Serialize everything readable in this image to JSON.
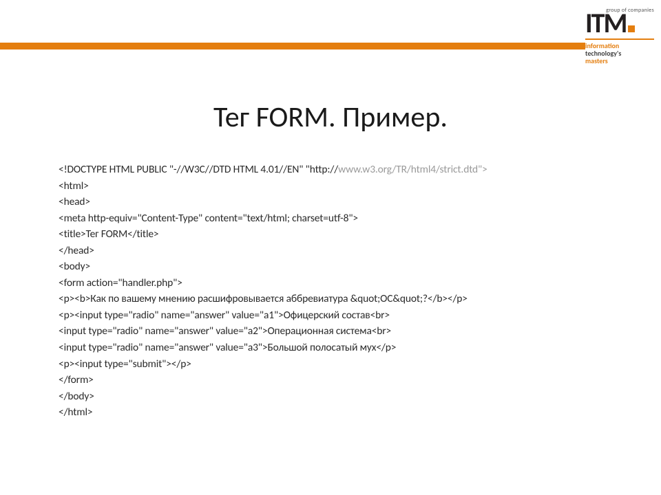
{
  "logo": {
    "group": "group of companies",
    "brand": "ITM",
    "tag1": "information",
    "tag2": "technology's",
    "tag3": "masters"
  },
  "title": "Тег FORM. Пример.",
  "code": {
    "l1a": "<!DOCTYPE HTML PUBLIC \"-//W3C//DTD HTML 4.01//EN\" \"http://",
    "l1b": "www.w3.org/TR/html4/strict.dtd\">",
    "l2": "<html>",
    "l3": " <head>",
    "l4": "  <meta http-equiv=\"Content-Type\" content=\"text/html; charset=utf-8\">",
    "l5": "  <title>Тег FORM</title>",
    "l6": " </head>",
    "l7": " <body>",
    "l8": " <form action=\"handler.php\">",
    "l9": "  <p><b>Как по вашему мнению расшифровывается аббревиатура &quot;ОС&quot;?</b></p>",
    "l10": "  <p><input type=\"radio\" name=\"answer\" value=\"a1\">Офицерский состав<br>",
    "l11": "  <input type=\"radio\" name=\"answer\" value=\"a2\">Операционная система<br>",
    "l12": "  <input type=\"radio\" name=\"answer\" value=\"a3\">Большой полосатый мух</p>",
    "l13": "  <p><input type=\"submit\"></p>",
    "l14": " </form>",
    "l15": " </body>",
    "l16": "</html>"
  }
}
